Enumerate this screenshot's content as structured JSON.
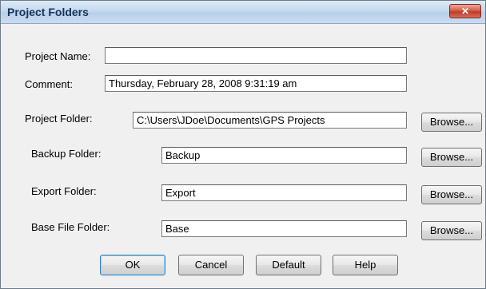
{
  "window": {
    "title": "Project Folders",
    "close_label": "✕"
  },
  "fields": {
    "project_name": {
      "label": "Project Name:",
      "value": ""
    },
    "comment": {
      "label": "Comment:",
      "value": "Thursday, February 28, 2008 9:31:19 am"
    },
    "project_folder": {
      "label": "Project Folder:",
      "value": "C:\\Users\\JDoe\\Documents\\GPS Projects"
    },
    "backup_folder": {
      "label": "Backup Folder:",
      "value": "Backup"
    },
    "export_folder": {
      "label": "Export Folder:",
      "value": "Export"
    },
    "base_file_folder": {
      "label": "Base File Folder:",
      "value": "Base"
    }
  },
  "browse_label": "Browse...",
  "buttons": {
    "ok": "OK",
    "cancel": "Cancel",
    "default": "Default",
    "help": "Help"
  }
}
